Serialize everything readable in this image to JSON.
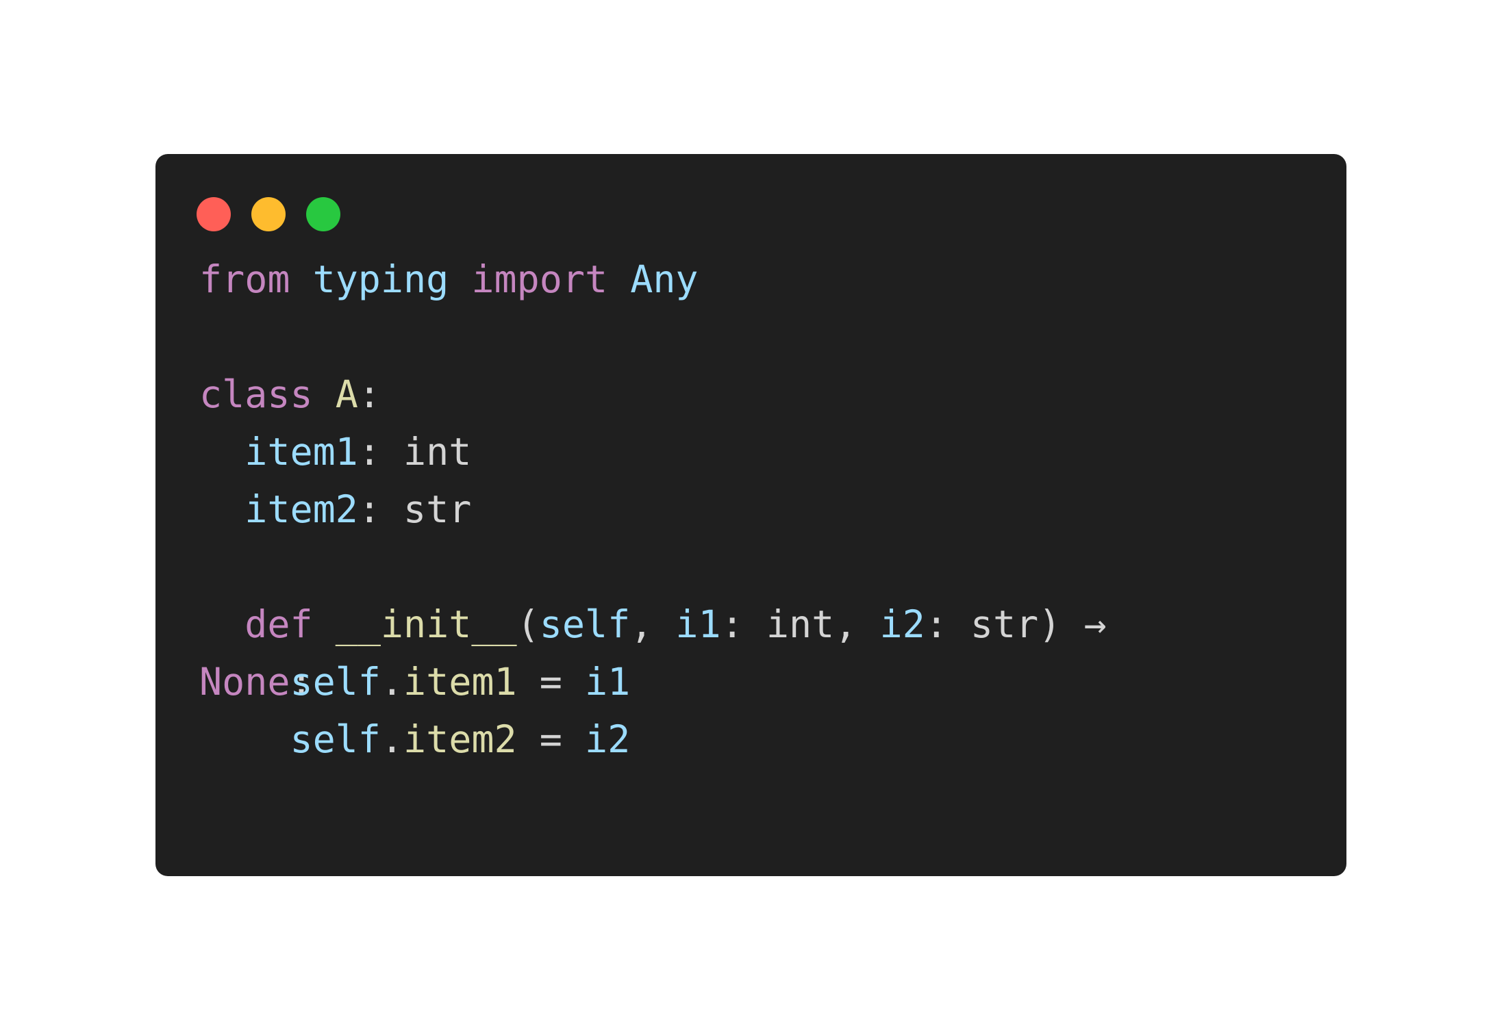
{
  "window": {
    "buttons": [
      {
        "name": "close",
        "color": "#ff5f57"
      },
      {
        "name": "minimize",
        "color": "#febc2e"
      },
      {
        "name": "zoom",
        "color": "#28c840"
      }
    ]
  },
  "colors": {
    "background": "#1f1f1f",
    "keyword": "#c586c0",
    "identifier": "#9cdcfe",
    "class_name": "#dcdcaa",
    "plain": "#d4d4d4"
  },
  "code": {
    "lines": [
      {
        "tokens": [
          {
            "text": "from",
            "kind": "keyword"
          },
          {
            "text": " ",
            "kind": "plain"
          },
          {
            "text": "typing",
            "kind": "identifier"
          },
          {
            "text": " ",
            "kind": "plain"
          },
          {
            "text": "import",
            "kind": "keyword"
          },
          {
            "text": " ",
            "kind": "plain"
          },
          {
            "text": "Any",
            "kind": "identifier"
          }
        ]
      },
      {
        "tokens": []
      },
      {
        "tokens": [
          {
            "text": "class",
            "kind": "keyword"
          },
          {
            "text": " ",
            "kind": "plain"
          },
          {
            "text": "A",
            "kind": "class_name"
          },
          {
            "text": ":",
            "kind": "plain"
          }
        ]
      },
      {
        "tokens": [
          {
            "text": "  ",
            "kind": "plain"
          },
          {
            "text": "item1",
            "kind": "identifier"
          },
          {
            "text": ": int",
            "kind": "plain"
          }
        ]
      },
      {
        "tokens": [
          {
            "text": "  ",
            "kind": "plain"
          },
          {
            "text": "item2",
            "kind": "identifier"
          },
          {
            "text": ": str",
            "kind": "plain"
          }
        ]
      },
      {
        "tokens": []
      },
      {
        "tokens": [
          {
            "text": "  ",
            "kind": "plain"
          },
          {
            "text": "def",
            "kind": "keyword"
          },
          {
            "text": " ",
            "kind": "plain"
          },
          {
            "text": "__init__",
            "kind": "class_name"
          },
          {
            "text": "(",
            "kind": "plain"
          },
          {
            "text": "self",
            "kind": "identifier"
          },
          {
            "text": ", ",
            "kind": "plain"
          },
          {
            "text": "i1",
            "kind": "identifier"
          },
          {
            "text": ": int, ",
            "kind": "plain"
          },
          {
            "text": "i2",
            "kind": "identifier"
          },
          {
            "text": ": str) →",
            "kind": "plain"
          }
        ]
      },
      {
        "tokens": [
          {
            "text": "None",
            "kind": "keyword"
          },
          {
            "text": ":",
            "kind": "plain"
          }
        ]
      },
      {
        "tokens": [
          {
            "text": "    ",
            "kind": "plain"
          },
          {
            "text": "self",
            "kind": "identifier"
          },
          {
            "text": ".",
            "kind": "plain"
          },
          {
            "text": "item2",
            "kind": "class_name"
          },
          {
            "text": " = ",
            "kind": "plain"
          },
          {
            "text": "i2",
            "kind": "identifier"
          }
        ]
      }
    ],
    "overlay_line": {
      "tokens": [
        {
          "text": "    ",
          "kind": "plain"
        },
        {
          "text": "self",
          "kind": "identifier"
        },
        {
          "text": ".",
          "kind": "plain"
        },
        {
          "text": "item1",
          "kind": "class_name"
        },
        {
          "text": " = ",
          "kind": "plain"
        },
        {
          "text": "i1",
          "kind": "identifier"
        }
      ]
    }
  }
}
